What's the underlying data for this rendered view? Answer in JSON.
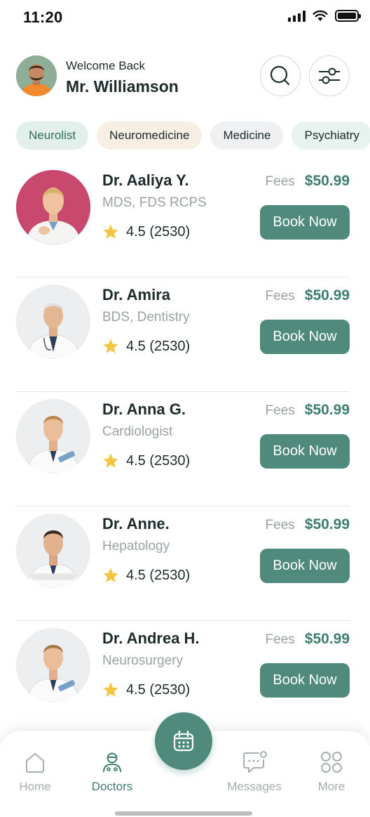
{
  "status": {
    "time": "11:20"
  },
  "header": {
    "welcome": "Welcome Back",
    "user_name": "Mr. Williamson"
  },
  "categories": [
    "Neurolist",
    "Neuromedicine",
    "Medicine",
    "Psychiatry"
  ],
  "doctors": [
    {
      "name": "Dr. Aaliya Y.",
      "specialty": "MDS, FDS RCPS",
      "rating": "4.5 (2530)",
      "fees_label": "Fees",
      "fees": "$50.99",
      "cta": "Book Now"
    },
    {
      "name": "Dr. Amira",
      "specialty": "BDS, Dentistry",
      "rating": "4.5 (2530)",
      "fees_label": "Fees",
      "fees": "$50.99",
      "cta": "Book Now"
    },
    {
      "name": "Dr. Anna G.",
      "specialty": "Cardiologist",
      "rating": "4.5 (2530)",
      "fees_label": "Fees",
      "fees": "$50.99",
      "cta": "Book Now"
    },
    {
      "name": "Dr. Anne.",
      "specialty": "Hepatology",
      "rating": "4.5 (2530)",
      "fees_label": "Fees",
      "fees": "$50.99",
      "cta": "Book Now"
    },
    {
      "name": "Dr. Andrea H.",
      "specialty": "Neurosurgery",
      "rating": "4.5 (2530)",
      "fees_label": "Fees",
      "fees": "$50.99",
      "cta": "Book Now"
    }
  ],
  "nav": [
    {
      "label": "Home",
      "icon": "home-icon"
    },
    {
      "label": "Doctors",
      "icon": "doctor-icon"
    },
    {
      "label": "Messages",
      "icon": "messages-icon"
    },
    {
      "label": "More",
      "icon": "grid-icon"
    }
  ],
  "colors": {
    "accent": "#4f8a7d",
    "accent_text": "#3e7e70",
    "muted_text": "#9aa2a2",
    "star": "#f5c542"
  }
}
